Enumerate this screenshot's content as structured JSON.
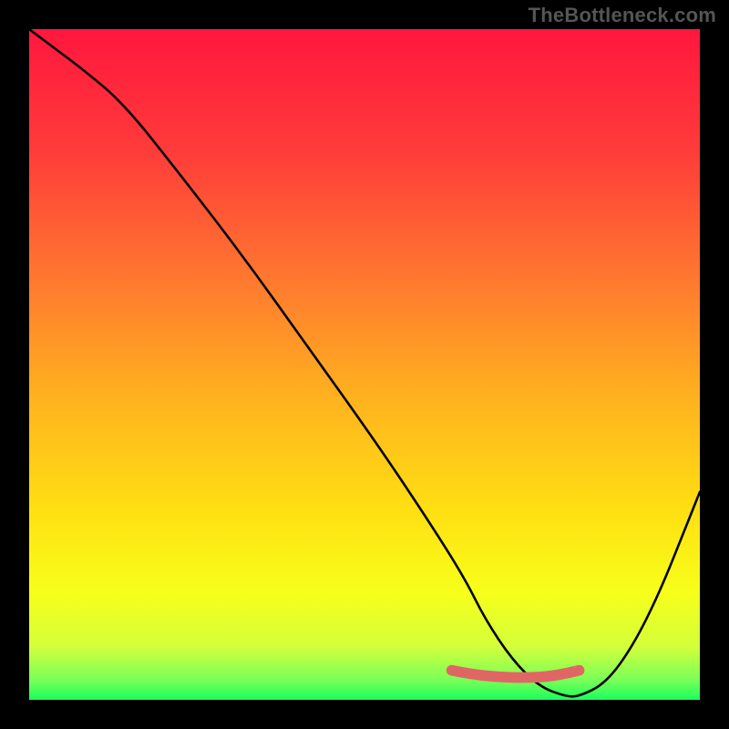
{
  "watermark": "TheBottleneck.com",
  "gradient": {
    "stops": [
      {
        "offset": "0%",
        "color": "#ff173e"
      },
      {
        "offset": "18%",
        "color": "#ff3b3a"
      },
      {
        "offset": "38%",
        "color": "#ff7a2f"
      },
      {
        "offset": "55%",
        "color": "#ffb21f"
      },
      {
        "offset": "72%",
        "color": "#ffe012"
      },
      {
        "offset": "84%",
        "color": "#f7ff1a"
      },
      {
        "offset": "92%",
        "color": "#d4ff3a"
      },
      {
        "offset": "97%",
        "color": "#7bff58"
      },
      {
        "offset": "100%",
        "color": "#1aff5c"
      }
    ]
  },
  "chart_data": {
    "type": "line",
    "title": "",
    "xlabel": "",
    "ylabel": "",
    "xlim": [
      0,
      100
    ],
    "ylim": [
      0,
      100
    ],
    "series": [
      {
        "name": "main-curve",
        "x": [
          0,
          4,
          8,
          14,
          22,
          32,
          42,
          52,
          60,
          65,
          68,
          72,
          76,
          80,
          82,
          86,
          90,
          94,
          98,
          100
        ],
        "y": [
          100,
          97,
          94,
          89,
          79,
          66,
          52,
          38,
          26,
          18,
          12,
          6,
          2,
          0.5,
          0.5,
          2.5,
          8,
          16,
          26,
          31
        ]
      }
    ],
    "marker_band": {
      "name": "optimal-band",
      "color": "#e06666",
      "x": [
        63,
        66,
        70,
        74,
        78,
        82
      ],
      "y": [
        4.4,
        3.8,
        3.4,
        3.3,
        3.5,
        4.4
      ]
    }
  }
}
